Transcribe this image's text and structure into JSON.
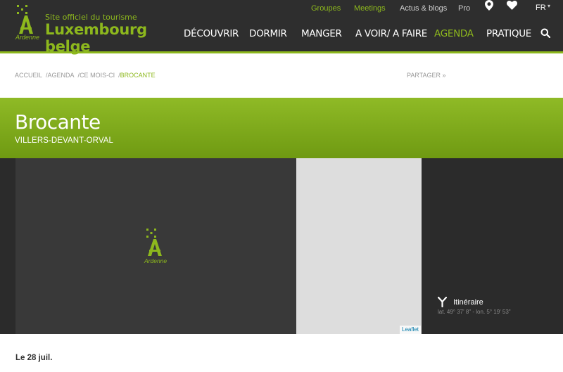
{
  "logo": {
    "tagline": "Site officiel du tourisme",
    "brand": "Luxembourg belge",
    "sub": "Ardenne"
  },
  "topnav": {
    "groupes": "Groupes",
    "meetings": "Meetings",
    "actus": "Actus & blogs",
    "pro": "Pro",
    "lang": "FR"
  },
  "mainnav": {
    "decouvrir": "DÉCOUVRIR",
    "dormir": "DORMIR",
    "manger": "MANGER",
    "avoir": "A VOIR/ A FAIRE",
    "agenda": "AGENDA",
    "pratique": "PRATIQUE"
  },
  "breadcrumb": {
    "items": [
      "ACCUEIL",
      "AGENDA",
      "CE MOIS-CI",
      "BROCANTE"
    ],
    "share": "PARTAGER »"
  },
  "event": {
    "title": "Brocante",
    "location": "VILLERS-DEVANT-ORVAL",
    "date": "Le 28 juil."
  },
  "media": {
    "photo_logo_text": "Ardenne",
    "leaflet": "Leaflet",
    "itinerary": "Itinéraire",
    "coords": "lat. 49° 37' 8\" - lon. 5° 19' 53\""
  },
  "colors": {
    "accent": "#8db81d",
    "header_bg": "#2e2e2e"
  }
}
